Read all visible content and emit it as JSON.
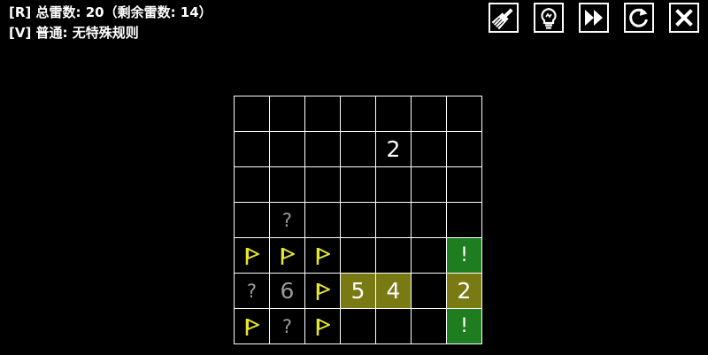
{
  "header": {
    "mines_line": "[R] 总雷数: 20（剩余雷数: 14）",
    "rule_line": "[V] 普通: 无特殊规则"
  },
  "toolbar": [
    {
      "name": "brush-button",
      "icon": "brush-icon"
    },
    {
      "name": "hint-button",
      "icon": "lightbulb-icon"
    },
    {
      "name": "fast-forward-button",
      "icon": "fast-forward-icon"
    },
    {
      "name": "restart-button",
      "icon": "restart-icon"
    },
    {
      "name": "close-button",
      "icon": "close-icon"
    }
  ],
  "colors": {
    "background": "#000000",
    "grid": "#ffffff",
    "flag": "#e6e62e",
    "highlight": "#7a7a14",
    "safe": "#1e7d1e",
    "grey_number": "#9a9a9a"
  },
  "board": {
    "rows": 7,
    "cols": 7,
    "cells": [
      [
        {
          "t": "e"
        },
        {
          "t": "e"
        },
        {
          "t": "e"
        },
        {
          "t": "e"
        },
        {
          "t": "e"
        },
        {
          "t": "e"
        },
        {
          "t": "e"
        }
      ],
      [
        {
          "t": "e"
        },
        {
          "t": "e"
        },
        {
          "t": "e"
        },
        {
          "t": "e"
        },
        {
          "t": "n",
          "v": "2"
        },
        {
          "t": "e"
        },
        {
          "t": "e"
        }
      ],
      [
        {
          "t": "e"
        },
        {
          "t": "e"
        },
        {
          "t": "e"
        },
        {
          "t": "e"
        },
        {
          "t": "e"
        },
        {
          "t": "e"
        },
        {
          "t": "e"
        }
      ],
      [
        {
          "t": "e"
        },
        {
          "t": "q",
          "v": "?"
        },
        {
          "t": "e"
        },
        {
          "t": "e"
        },
        {
          "t": "e"
        },
        {
          "t": "e"
        },
        {
          "t": "e"
        }
      ],
      [
        {
          "t": "f"
        },
        {
          "t": "f"
        },
        {
          "t": "f"
        },
        {
          "t": "e"
        },
        {
          "t": "e"
        },
        {
          "t": "e"
        },
        {
          "t": "s",
          "v": "!"
        }
      ],
      [
        {
          "t": "q",
          "v": "?"
        },
        {
          "t": "g",
          "v": "6"
        },
        {
          "t": "f"
        },
        {
          "t": "h",
          "v": "5"
        },
        {
          "t": "h",
          "v": "4"
        },
        {
          "t": "e"
        },
        {
          "t": "h",
          "v": "2"
        }
      ],
      [
        {
          "t": "f"
        },
        {
          "t": "q",
          "v": "?"
        },
        {
          "t": "f"
        },
        {
          "t": "e"
        },
        {
          "t": "e"
        },
        {
          "t": "e"
        },
        {
          "t": "s",
          "v": "!"
        }
      ]
    ]
  }
}
